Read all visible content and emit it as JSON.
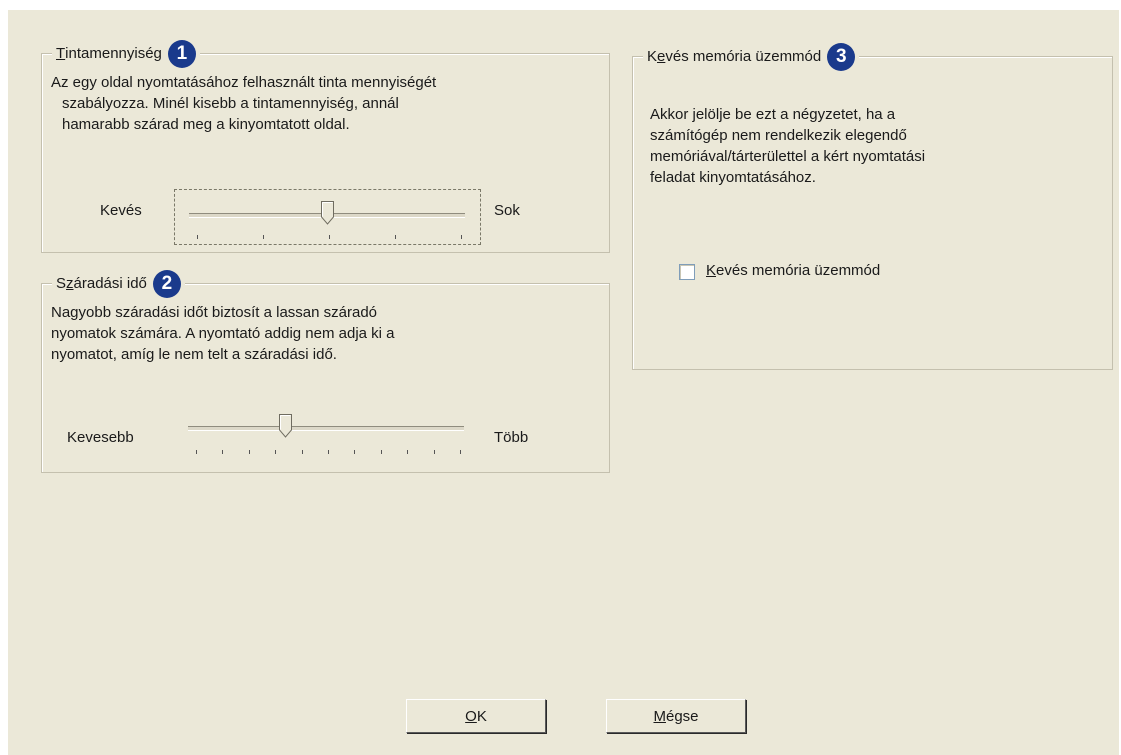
{
  "ink_group": {
    "legend_mnemonic": "T",
    "legend_rest": "intamennyiség",
    "badge": "1",
    "description": [
      "Az egy oldal nyomtatásához felhasznált tinta mennyiségét",
      "szabályozza. Minél kisebb a tintamennyiség, annál",
      "hamarabb szárad meg a kinyomtatott oldal."
    ],
    "min_label": "Kevés",
    "max_label": "Sok",
    "slider_value": 0.5
  },
  "dry_group": {
    "legend_pre": "S",
    "legend_mnemonic": "z",
    "legend_rest": "áradási idő",
    "badge": "2",
    "description": [
      "Nagyobb száradási időt biztosít a lassan száradó",
      "nyomatok számára. A nyomtató addig nem adja ki a",
      "nyomatot, amíg le nem telt a száradási idő."
    ],
    "min_label": "Kevesebb",
    "max_label": "Több",
    "slider_value": 0.35
  },
  "mem_group": {
    "legend_pre": "K",
    "legend_mnemonic": "e",
    "legend_rest": "vés memória üzemmód",
    "badge": "3",
    "description": [
      "Akkor jelölje be ezt a négyzetet, ha a",
      "számítógép nem rendelkezik elegendő",
      "memóriával/tárterülettel a kért nyomtatási",
      "feladat kinyomtatásához."
    ],
    "checkbox_mnemonic": "K",
    "checkbox_rest": "evés memória üzemmód",
    "checked": false
  },
  "buttons": {
    "ok_mnemonic": "O",
    "ok_rest": "K",
    "cancel_mnemonic": "M",
    "cancel_rest": "égse"
  }
}
